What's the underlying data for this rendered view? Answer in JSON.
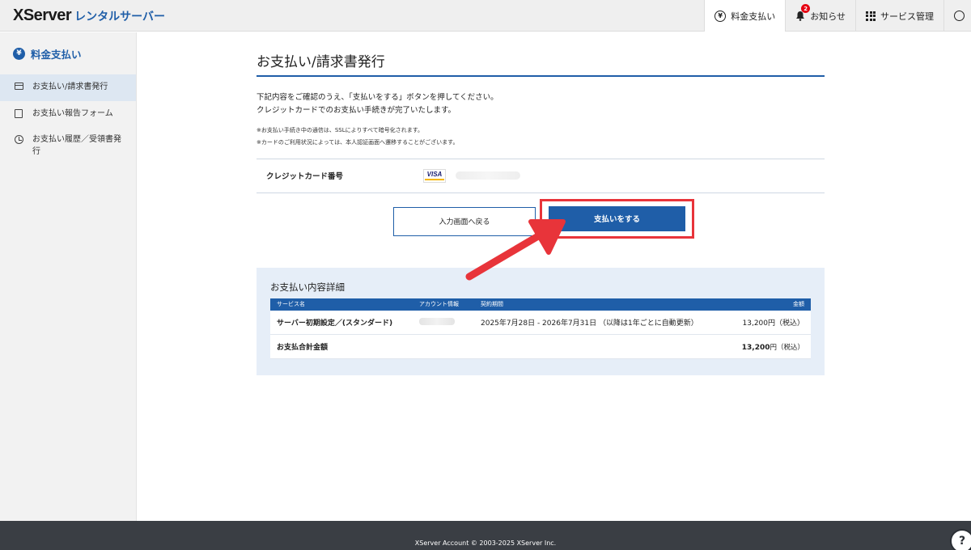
{
  "header": {
    "brand": "XServer",
    "brand_sub": "レンタルサーバー",
    "nav": [
      {
        "label": "料金支払い",
        "icon": "yen-icon"
      },
      {
        "label": "お知らせ",
        "icon": "bell-icon",
        "badge": "2"
      },
      {
        "label": "サービス管理",
        "icon": "grid-icon"
      }
    ]
  },
  "sidebar": {
    "title": "料金支払い",
    "items": [
      {
        "label": "お支払い/請求書発行",
        "icon": "card-icon"
      },
      {
        "label": "お支払い報告フォーム",
        "icon": "form-icon"
      },
      {
        "label": "お支払い履歴／受領書発行",
        "icon": "clock-icon"
      }
    ]
  },
  "main": {
    "title": "お支払い/請求書発行",
    "intro_1": "下記内容をご確認のうえ、「支払いをする」ボタンを押してください。",
    "intro_2": "クレジットカードでのお支払い手続きが完了いたします。",
    "note_1": "※お支払い手続き中の通信は、SSLによりすべて暗号化されます。",
    "note_2": "※カードのご利用状況によっては、本人認証画面へ遷移することがございます。",
    "card_label": "クレジットカード番号",
    "card_brand": "VISA",
    "back_button": "入力画面へ戻る",
    "pay_button": "支払いをする"
  },
  "details": {
    "title": "お支払い内容詳細",
    "columns": [
      "サービス名",
      "アカウント情報",
      "契約期間",
      "金額"
    ],
    "row": {
      "service": "サーバー初期設定／(スタンダード)",
      "period": "2025年7月28日 - 2026年7月31日 （以降は1年ごとに自動更新）",
      "amount": "13,200円（税込）"
    },
    "total_label": "お支払合計金額",
    "total_amount": "13,200",
    "total_suffix": "円（税込）"
  },
  "footer": {
    "copyright": "XServer Account © 2003-2025 XServer Inc.",
    "help": "?"
  },
  "colors": {
    "accent": "#1f5ea8",
    "highlight": "#e8343a"
  }
}
